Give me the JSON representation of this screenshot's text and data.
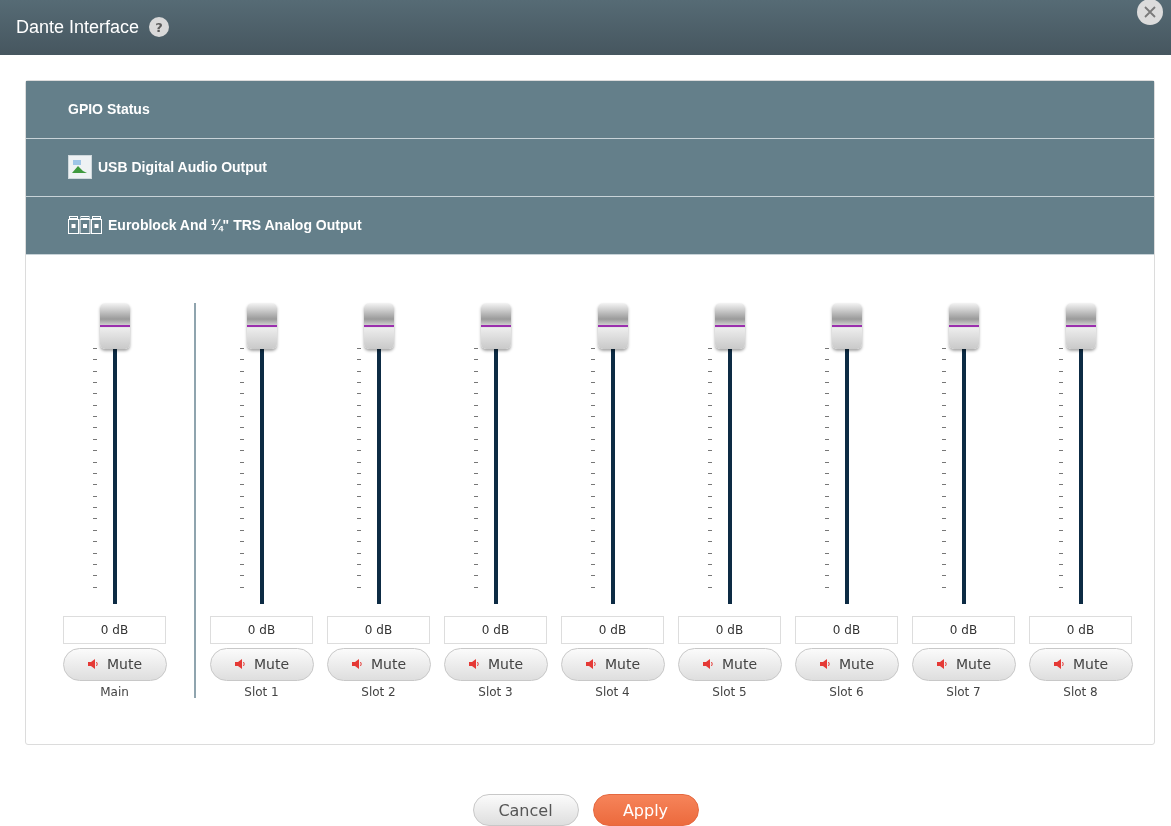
{
  "window": {
    "title": "Dante Interface",
    "help": "?"
  },
  "sections": [
    {
      "label": "GPIO Status",
      "kind": "plain"
    },
    {
      "label": "USB Digital Audio Output",
      "kind": "image"
    },
    {
      "label": "Euroblock And ¼\" TRS Analog Output",
      "kind": "connector"
    }
  ],
  "channels": [
    {
      "label": "Main",
      "value": "0 dB",
      "muted": false,
      "mute_label": "Mute"
    },
    {
      "label": "Slot 1",
      "value": "0 dB",
      "muted": false,
      "mute_label": "Mute"
    },
    {
      "label": "Slot 2",
      "value": "0 dB",
      "muted": false,
      "mute_label": "Mute"
    },
    {
      "label": "Slot 3",
      "value": "0 dB",
      "muted": false,
      "mute_label": "Mute"
    },
    {
      "label": "Slot 4",
      "value": "0 dB",
      "muted": false,
      "mute_label": "Mute"
    },
    {
      "label": "Slot 5",
      "value": "0 dB",
      "muted": false,
      "mute_label": "Mute"
    },
    {
      "label": "Slot 6",
      "value": "0 dB",
      "muted": false,
      "mute_label": "Mute"
    },
    {
      "label": "Slot 7",
      "value": "0 dB",
      "muted": false,
      "mute_label": "Mute"
    },
    {
      "label": "Slot 8",
      "value": "0 dB",
      "muted": false,
      "mute_label": "Mute"
    }
  ],
  "buttons": [
    {
      "label": "Cancel",
      "kind": "secondary"
    },
    {
      "label": "Apply",
      "kind": "primary"
    }
  ]
}
